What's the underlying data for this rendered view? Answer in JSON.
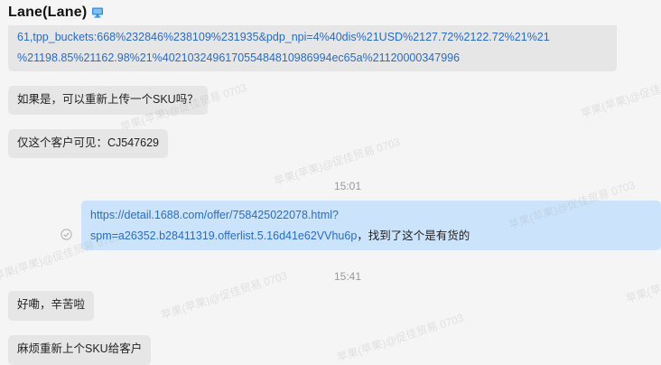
{
  "header": {
    "contact_name": "Lane(Lane)"
  },
  "messages": {
    "link_continuation_line1": "61,tpp_buckets:668%232846%238109%231935&pdp_npi=4%40dis%21USD%2127.72%2122.72%21%21",
    "link_continuation_line2": "%21198.85%21162.98%21%402103249617055484810986994ec65a%21120000347996",
    "msg_reupload_question": "如果是，可以重新上传一个SKU吗？",
    "msg_customer_visible": "仅这个客户可见：CJ547629",
    "time_1": "15:01",
    "outgoing_link_line1": "https://detail.1688.com/offer/758425022078.html?",
    "outgoing_link_line2": "spm=a26352.b28411319.offerlist.5.16d41e62VVhu6p",
    "outgoing_text": "，找到了这个是有货的",
    "time_2": "15:41",
    "msg_ok_thanks": "好嘞，辛苦啦",
    "msg_reupload_sku": "麻烦重新上个SKU给客户"
  },
  "watermark": {
    "text": "苹果(苹果)@促佳贸易 0703"
  }
}
